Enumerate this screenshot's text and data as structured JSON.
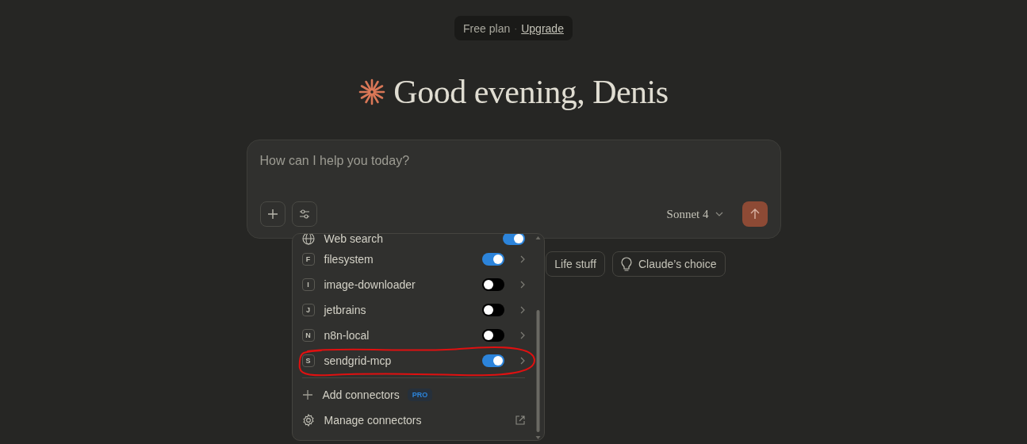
{
  "plan_banner": {
    "plan": "Free plan",
    "separator": "·",
    "link": "Upgrade"
  },
  "greeting": "Good evening, Denis",
  "composer": {
    "placeholder": "How can I help you today?",
    "model": "Sonnet 4"
  },
  "prompt_chips": [
    {
      "label": "Life stuff"
    },
    {
      "label": "Claude’s choice"
    }
  ],
  "connector_menu": {
    "items": [
      {
        "kind": "toggle",
        "label": "Web search",
        "on": true,
        "selected": false
      },
      {
        "kind": "toggle",
        "label": "filesystem",
        "badge": "F",
        "on": true,
        "selected": false
      },
      {
        "kind": "toggle",
        "label": "image-downloader",
        "badge": "I",
        "on": false,
        "selected": false
      },
      {
        "kind": "toggle",
        "label": "jetbrains",
        "badge": "J",
        "on": false,
        "selected": false
      },
      {
        "kind": "toggle",
        "label": "n8n-local",
        "badge": "N",
        "on": false,
        "selected": false
      },
      {
        "kind": "toggle",
        "label": "sendgrid-mcp",
        "badge": "S",
        "on": true,
        "selected": true
      },
      {
        "kind": "add",
        "label": "Add connectors",
        "tag": "PRO"
      },
      {
        "kind": "manage",
        "label": "Manage connectors"
      }
    ]
  }
}
